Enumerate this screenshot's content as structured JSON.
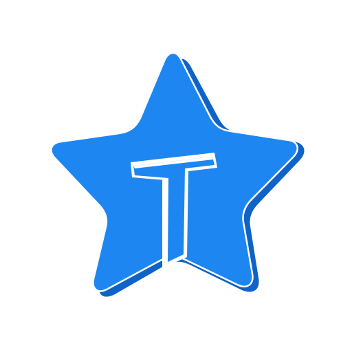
{
  "icon": {
    "name": "star-t-logo-icon",
    "colors": {
      "star_fill": "#1E86F0",
      "star_shadow": "#0F62C8",
      "outline": "#ffffff",
      "background": "#ffffff"
    }
  }
}
